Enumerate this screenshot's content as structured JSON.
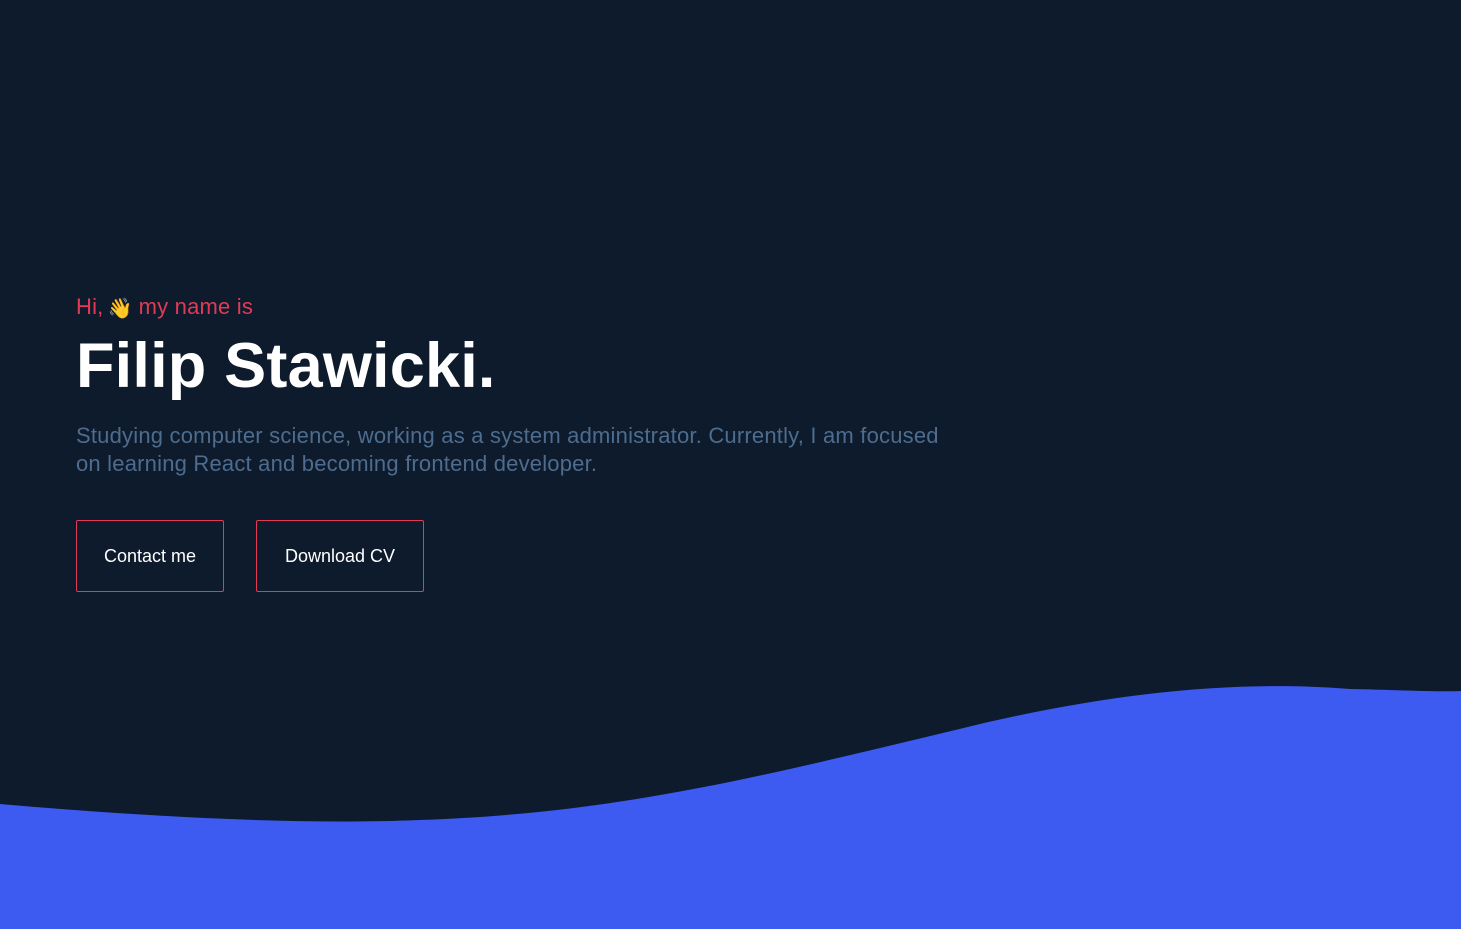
{
  "hero": {
    "greeting_before": "Hi,",
    "greeting_emoji": "👋",
    "greeting_after": "my name is",
    "name": "Filip Stawicki.",
    "tagline": "Studying computer science, working as a system administrator. Currently, I am focused on learning React and becoming frontend developer."
  },
  "actions": {
    "contact_label": "Contact me",
    "cv_label": "Download CV"
  },
  "colors": {
    "background": "#0d1b2c",
    "accent": "#e23a55",
    "wave": "#3d5af1",
    "tagline": "#4e6c8e"
  },
  "icons": {
    "wave_emoji": "waving-hand-icon"
  }
}
